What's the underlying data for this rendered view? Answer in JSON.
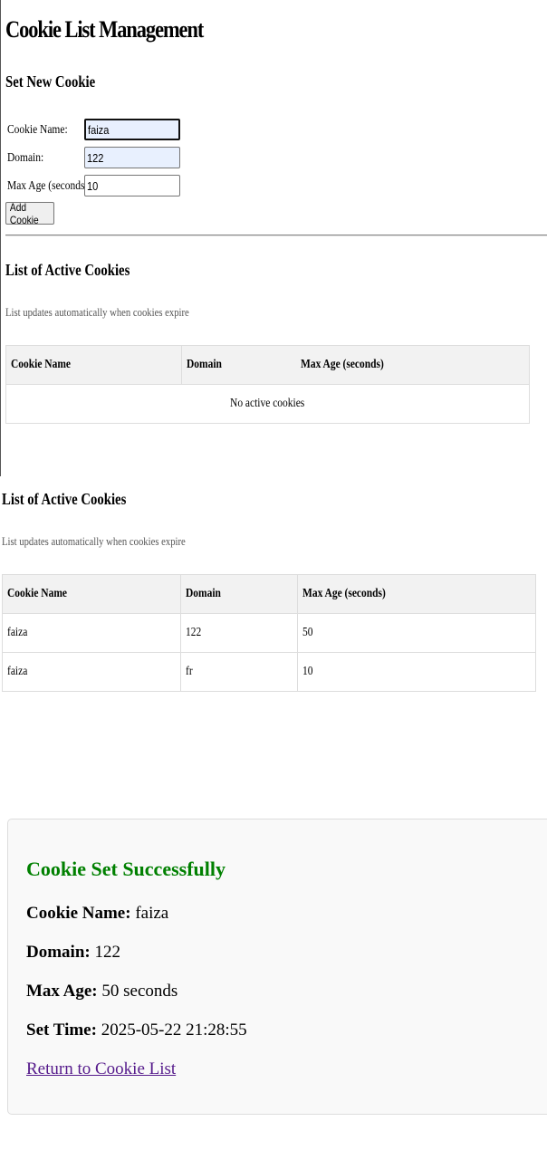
{
  "page": {
    "title": "Cookie List Management"
  },
  "form": {
    "heading": "Set New Cookie",
    "name_label": "Cookie Name:",
    "name_value": "faiza",
    "domain_label": "Domain:",
    "domain_value": "122",
    "max_age_label": "Max Age (seconds):",
    "max_age_value": "10",
    "submit_label": "Add Cookie"
  },
  "active_list": {
    "heading": "List of Active Cookies",
    "note": "List updates automatically when cookies expire",
    "columns": [
      "Cookie Name",
      "Domain",
      "Max Age (seconds)"
    ],
    "empty_text": "No active cookies"
  },
  "active_list_2": {
    "heading": "List of Active Cookies",
    "note": "List updates automatically when cookies expire",
    "columns": [
      "Cookie Name",
      "Domain",
      "Max Age (seconds)"
    ],
    "rows": [
      [
        "faiza",
        "122",
        "50"
      ],
      [
        "faiza",
        "fr",
        "10"
      ]
    ]
  },
  "success": {
    "title": "Cookie Set Successfully",
    "name_label": "Cookie Name:",
    "name_value": "faiza",
    "domain_label": "Domain:",
    "domain_value": "122",
    "max_age_label": "Max Age:",
    "max_age_value": "50 seconds",
    "set_time_label": "Set Time:",
    "set_time_value": "2025-05-22 21:28:55",
    "return_link": "Return to Cookie List"
  },
  "colors": {
    "success_green": "#008000",
    "link_visited": "#551a8b",
    "autofill_bg": "#e8f0fe",
    "header_bg": "#f2f2f2"
  }
}
